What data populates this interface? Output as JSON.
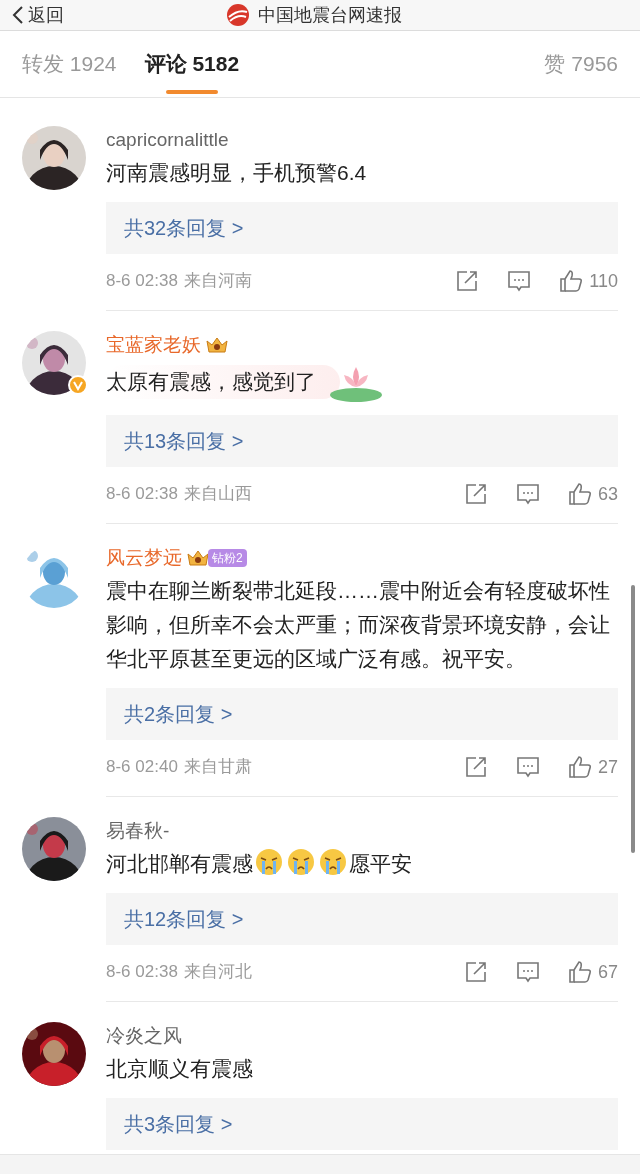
{
  "header": {
    "back_label": "返回",
    "title": "中国地震台网速报"
  },
  "tabs": [
    {
      "label": "转发 1924",
      "selected": false
    },
    {
      "label": "评论 5182",
      "selected": true
    },
    {
      "label": "赞 7956",
      "selected": false
    }
  ],
  "comments": [
    {
      "name": "capricornalittle",
      "vip": false,
      "verified": false,
      "bubble": false,
      "content": [
        {
          "kind": "text",
          "text": "河南震感明显，手机预警6.4"
        }
      ],
      "replies": "共32条回复 >",
      "time": "8-6 02:38",
      "source": "来自河南",
      "likes": "110"
    },
    {
      "name": "宝蓝家老妖",
      "vip": true,
      "verified": true,
      "badges": [
        {
          "kind": "crown"
        }
      ],
      "bubble": true,
      "content": [
        {
          "kind": "text",
          "text": "太原有震感，感觉到了"
        }
      ],
      "replies": "共13条回复 >",
      "time": "8-6 02:38",
      "source": "来自山西",
      "likes": "63"
    },
    {
      "name": "风云梦远",
      "vip": true,
      "verified": false,
      "badges": [
        {
          "kind": "crown"
        },
        {
          "kind": "fan",
          "text": "钻粉2"
        }
      ],
      "bubble": false,
      "content": [
        {
          "kind": "text",
          "text": "震中在聊兰断裂带北延段……震中附近会有轻度破坏性影响，但所幸不会太严重；而深夜背景环境安静，会让华北平原甚至更远的区域广泛有感。祝平安。"
        }
      ],
      "replies": "共2条回复 >",
      "time": "8-6 02:40",
      "source": "来自甘肃",
      "likes": "27"
    },
    {
      "name": "易春秋-",
      "vip": false,
      "verified": false,
      "bubble": false,
      "content": [
        {
          "kind": "text",
          "text": "河北邯郸有震感"
        },
        {
          "kind": "emoji"
        },
        {
          "kind": "emoji"
        },
        {
          "kind": "emoji"
        },
        {
          "kind": "text",
          "text": "愿平安"
        }
      ],
      "replies": "共12条回复 >",
      "time": "8-6 02:38",
      "source": "来自河北",
      "likes": "67"
    },
    {
      "name": "冷炎之风",
      "vip": false,
      "verified": false,
      "bubble": false,
      "content": [
        {
          "kind": "text",
          "text": "北京顺义有震感"
        }
      ],
      "replies": "共3条回复 >"
    }
  ]
}
